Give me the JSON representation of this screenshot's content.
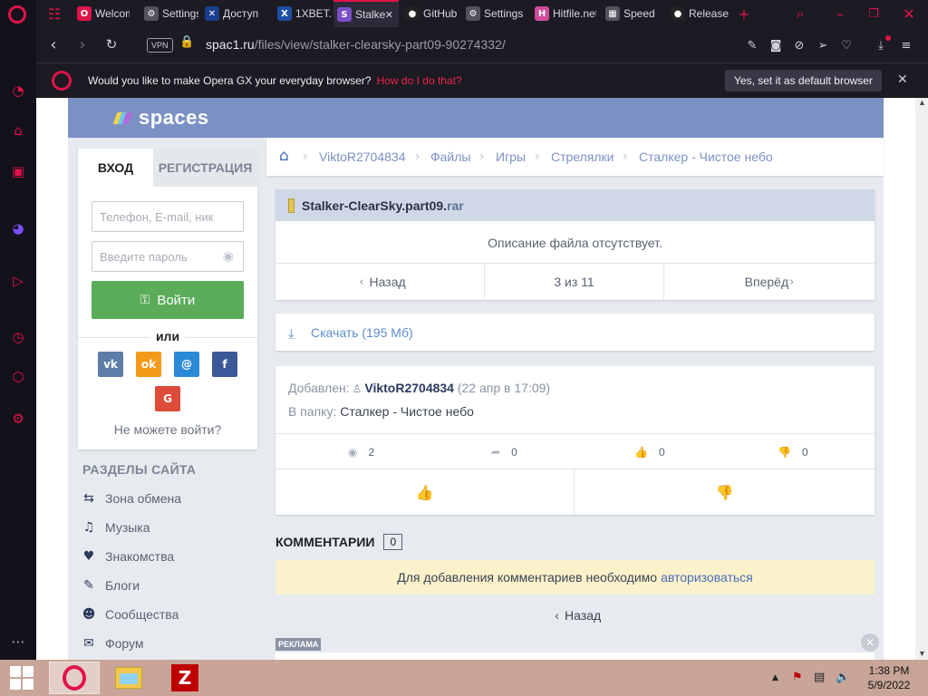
{
  "browser": {
    "tabs": [
      {
        "label": "Welcome",
        "icon": "opera-icon",
        "color": "#e0134a",
        "glyph": "O"
      },
      {
        "label": "Settings",
        "icon": "gear-icon",
        "color": "#55525e",
        "glyph": "⚙"
      },
      {
        "label": "Доступ",
        "icon": "site-icon",
        "color": "#1a3e8c",
        "glyph": "✕"
      },
      {
        "label": "1XBET.",
        "icon": "xbet-icon",
        "color": "#1e4fa3",
        "glyph": "X"
      },
      {
        "label": "Stalker",
        "icon": "spaces-icon",
        "color": "#7c4ec4",
        "glyph": "S",
        "active": true
      },
      {
        "label": "GitHub",
        "icon": "github-icon",
        "color": "#222222",
        "glyph": "●"
      },
      {
        "label": "Settings",
        "icon": "gear-icon",
        "color": "#55525e",
        "glyph": "⚙"
      },
      {
        "label": "Hitfile.net",
        "icon": "hitfile-icon",
        "color": "#d04a9a",
        "glyph": "H"
      },
      {
        "label": "Speed",
        "icon": "speed-icon",
        "color": "#55525e",
        "glyph": "▦"
      },
      {
        "label": "Release",
        "icon": "github-icon",
        "color": "#222222",
        "glyph": "●"
      }
    ],
    "vpn_label": "VPN",
    "url_host": "spac1.ru",
    "url_path": "/files/view/stalker-clearsky-part09-90274332/",
    "notification": {
      "message": "Would you like to make Opera GX your everyday browser?",
      "link": "How do I do that?",
      "button": "Yes, set it as default browser"
    },
    "accent": "#e0134a"
  },
  "site": {
    "logo_text": "spaces",
    "header_color": "#7c91c3"
  },
  "login": {
    "tab_login": "ВХОД",
    "tab_register": "РЕГИСТРАЦИЯ",
    "login_placeholder": "Телефон, E-mail, ник",
    "password_placeholder": "Введите пароль",
    "submit": "Войти",
    "or": "или",
    "social": [
      {
        "name": "vk",
        "glyph": "vk",
        "color": "#5b7da7"
      },
      {
        "name": "odnoklassniki",
        "glyph": "ok",
        "color": "#f39a1a"
      },
      {
        "name": "mail",
        "glyph": "@",
        "color": "#2b8ad8"
      },
      {
        "name": "facebook",
        "glyph": "f",
        "color": "#3b5998"
      },
      {
        "name": "google",
        "glyph": "G",
        "color": "#dd4b39"
      }
    ],
    "cant_login": "Не можете войти?"
  },
  "sections": {
    "title": "РАЗДЕЛЫ САЙТА",
    "items": [
      {
        "label": "Зона обмена",
        "icon": "exchange-icon",
        "glyph": "⇆"
      },
      {
        "label": "Музыка",
        "icon": "music-icon",
        "glyph": "♫"
      },
      {
        "label": "Знакомства",
        "icon": "heart-icon",
        "glyph": "♥"
      },
      {
        "label": "Блоги",
        "icon": "pen-icon",
        "glyph": "✎"
      },
      {
        "label": "Сообщества",
        "icon": "community-icon",
        "glyph": "☻"
      },
      {
        "label": "Форум",
        "icon": "forum-icon",
        "glyph": "✉"
      }
    ]
  },
  "breadcrumb": [
    "ViktoR2704834",
    "Файлы",
    "Игры",
    "Стрелялки",
    "Сталкер - Чистое небо"
  ],
  "file": {
    "name": "Stalker-ClearSky.part09.",
    "ext": "rar",
    "description": "Описание файла отсутствует.",
    "pager": {
      "prev": "Назад",
      "position": "3 из 11",
      "next": "Вперёд"
    },
    "download": "Скачать (195 Мб)",
    "added_label": "Добавлен:",
    "author": "ViktoR2704834",
    "added_date": "(22 апр в 17:09)",
    "folder_label": "В папку:",
    "folder": "Сталкер - Чистое небо",
    "stats": {
      "views": "2",
      "shares": "0",
      "likes": "0",
      "dislikes": "0"
    }
  },
  "comments": {
    "title": "КОММЕНТАРИИ",
    "count": "0",
    "auth_text": "Для добавления комментариев необходимо",
    "auth_link": "авторизоваться",
    "back": "Назад"
  },
  "ad_label": "РЕКЛАМА",
  "taskbar": {
    "time": "1:38 PM",
    "date": "5/9/2022"
  }
}
